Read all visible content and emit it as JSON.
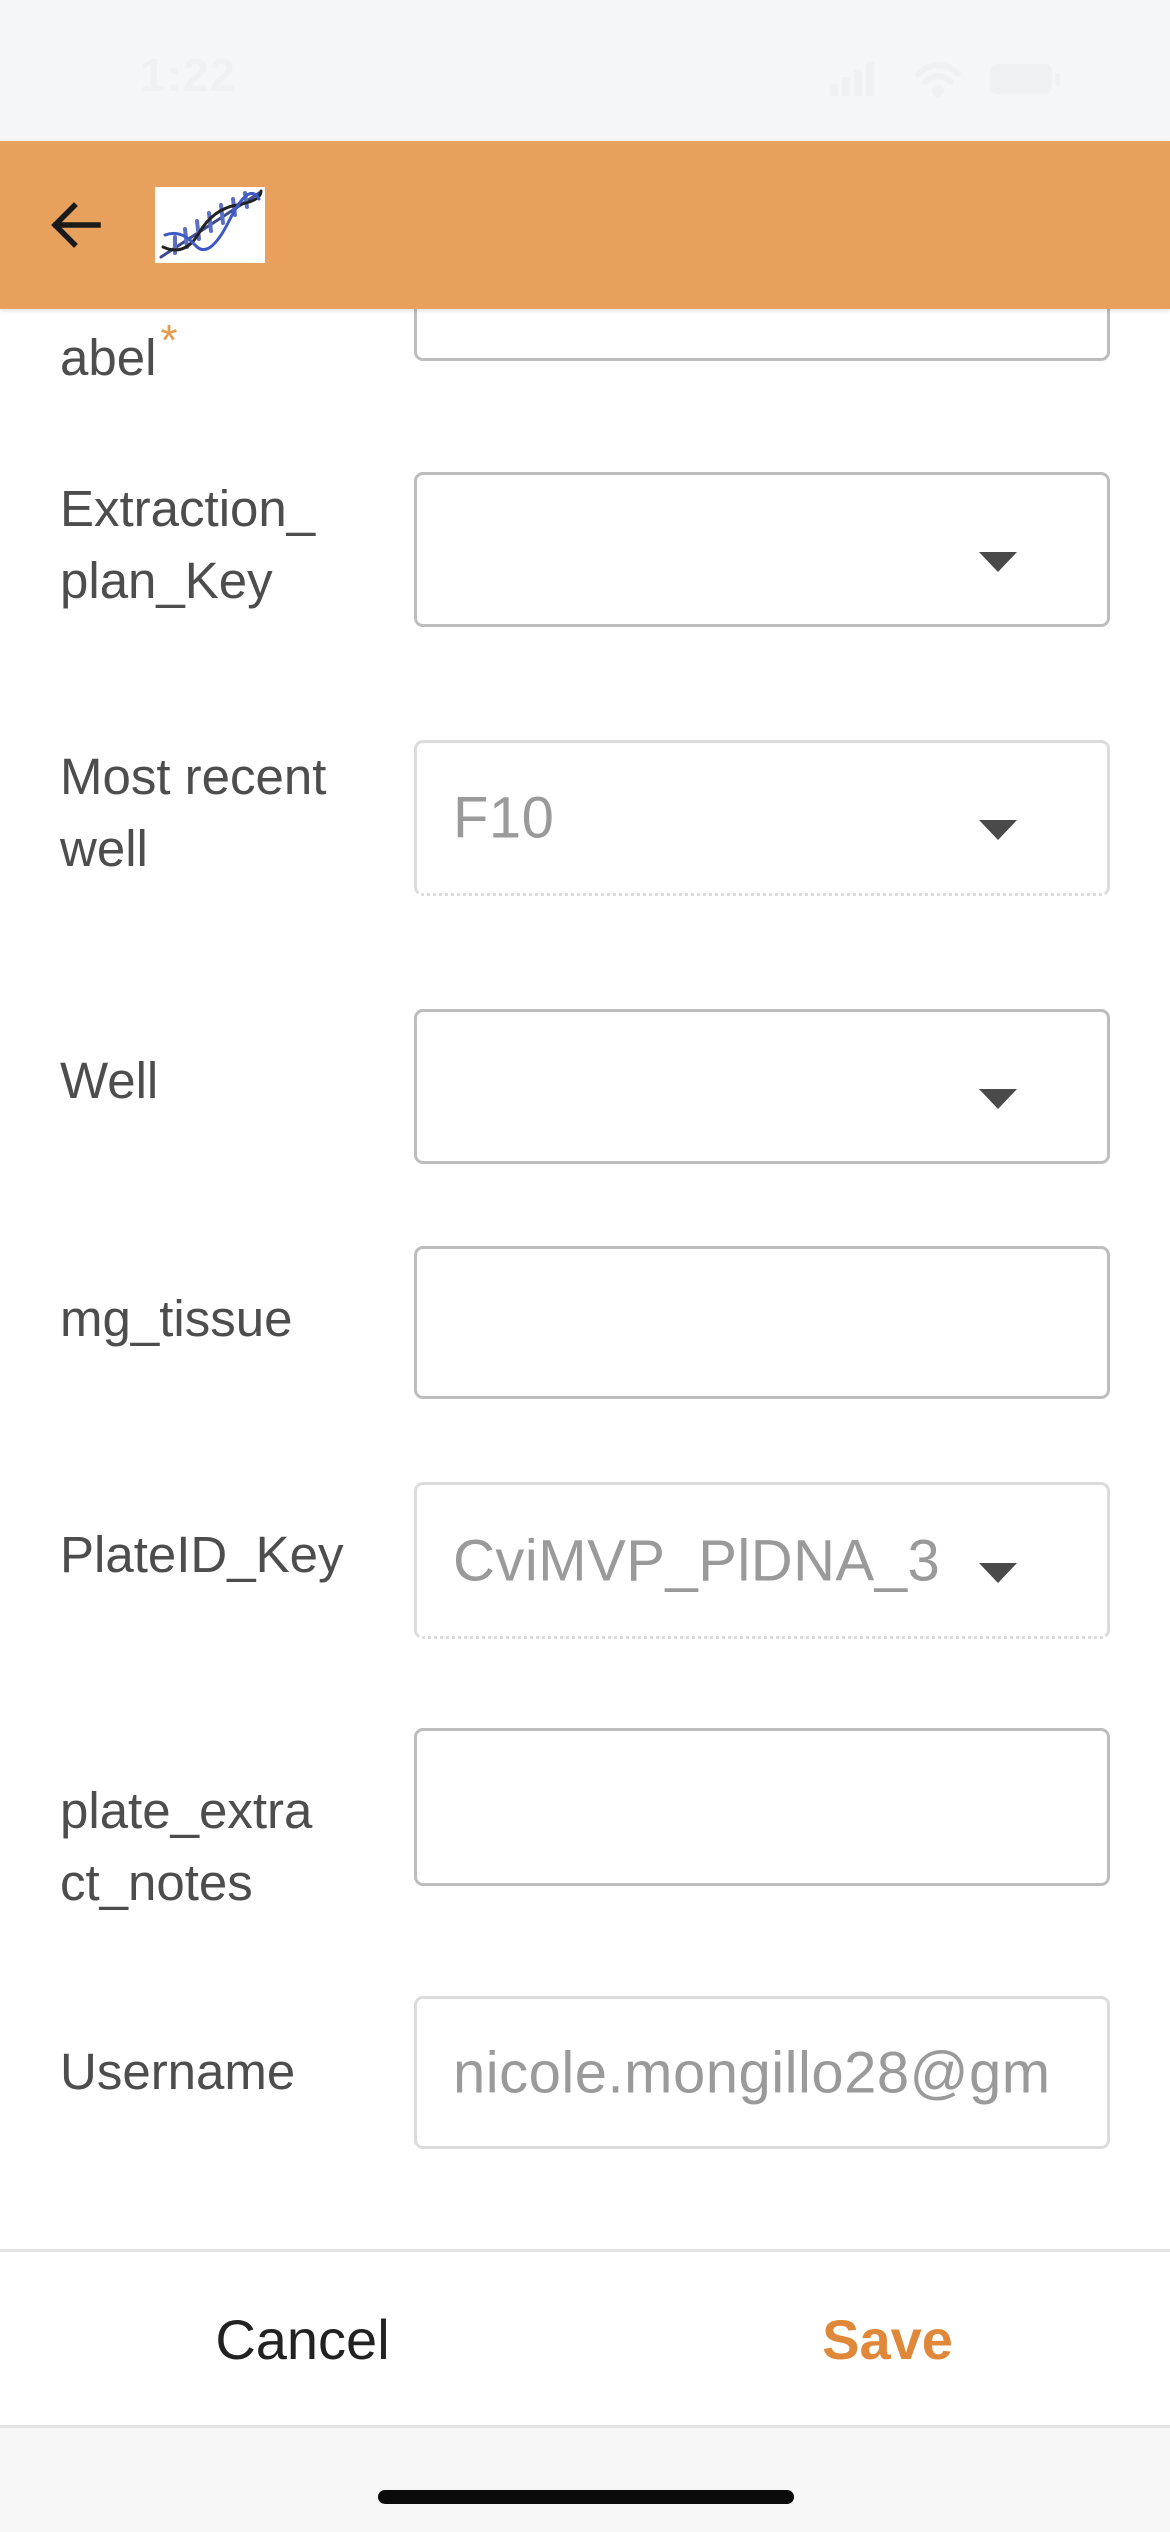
{
  "status_bar": {
    "time": "1:22",
    "icons": [
      "cellular-signal-icon",
      "wifi-icon",
      "battery-icon"
    ]
  },
  "header": {
    "back_icon": "arrow-left-icon",
    "logo_icon": "dna-helix-logo",
    "background_color": "#e8a15c"
  },
  "form": {
    "fields": [
      {
        "label": "abel",
        "required": true,
        "type": "text",
        "value": ""
      },
      {
        "label": "Extraction_\nplan_Key",
        "type": "select",
        "value": ""
      },
      {
        "label": "Most recent\nwell",
        "type": "select",
        "value": "F10",
        "readonly": true
      },
      {
        "label": "Well",
        "type": "select",
        "value": ""
      },
      {
        "label": "mg_tissue",
        "type": "text",
        "value": ""
      },
      {
        "label": "PlateID_Key",
        "type": "select",
        "value": "CviMVP_PlDNA_3",
        "readonly": true
      },
      {
        "label": "plate_extra\nct_notes",
        "type": "text",
        "value": ""
      },
      {
        "label": "Username",
        "type": "text",
        "value": "nicole.mongillo28@gm",
        "readonly": true
      }
    ]
  },
  "actions": {
    "cancel_label": "Cancel",
    "save_label": "Save",
    "save_color": "#e0883a"
  }
}
